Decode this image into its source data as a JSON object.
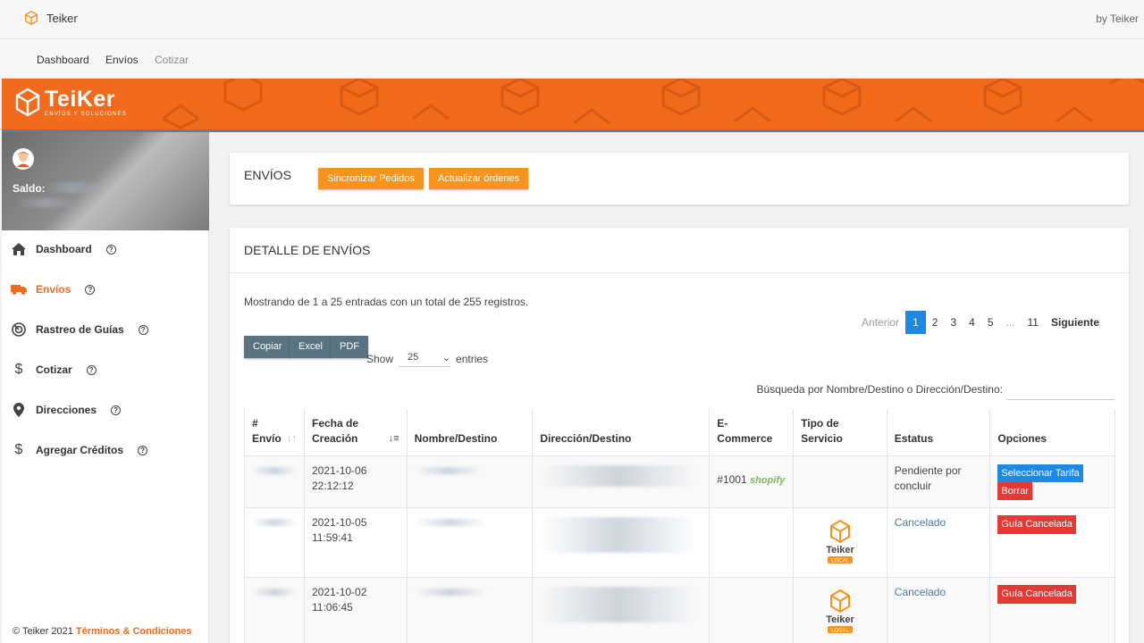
{
  "app": {
    "name": "Teiker",
    "by": "by Teiker"
  },
  "subnav": {
    "dashboard": "Dashboard",
    "envios": "Envíos",
    "cotizar": "Cotizar"
  },
  "banner": {
    "word": "TeiKer",
    "tagline": "ENVÍOS Y SOLUCIONES"
  },
  "profile": {
    "saldo_label": "Saldo:"
  },
  "sidebar": {
    "items": [
      {
        "label": "Dashboard",
        "icon": "home-icon"
      },
      {
        "label": "Envíos",
        "icon": "truck-icon",
        "active": true
      },
      {
        "label": "Rastreo de Guías",
        "icon": "radar-icon"
      },
      {
        "label": "Cotizar",
        "icon": "dollar-icon"
      },
      {
        "label": "Direcciones",
        "icon": "map-pin-icon"
      },
      {
        "label": "Agregar Créditos",
        "icon": "dollar-icon"
      }
    ],
    "help_glyph": "?",
    "footer_text": "© Teiker 2021",
    "footer_link": "Términos & Condiciones"
  },
  "envios_card": {
    "title": "ENVÍOS",
    "sync_button": "Sincronizar Pedidos",
    "update_button": "Actualizar órdenes"
  },
  "detail": {
    "title": "DETALLE DE ENVÍOS",
    "info": "Mostrando de 1 a 25 entradas con un total de 255 registros.",
    "pager": {
      "prev": "Anterior",
      "pages": [
        "1",
        "2",
        "3",
        "4",
        "5",
        "...",
        "11"
      ],
      "next": "Siguiente",
      "current": "1"
    },
    "export_buttons": [
      "Copiar",
      "Excel",
      "PDF"
    ],
    "show_label": "Show",
    "show_value": "25",
    "entries_label": "entries",
    "search_label": "Búsqueda por Nombre/Destino o Dirección/Destino:",
    "columns": {
      "envio_1": "#",
      "envio_2": "Envío",
      "fecha_1": "Fecha de",
      "fecha_2": "Creación",
      "nombre": "Nombre/Destino",
      "direccion": "Dirección/Destino",
      "ecom_1": "E-",
      "ecom_2": "Commerce",
      "tipo_1": "Tipo de",
      "tipo_2": "Servicio",
      "estatus": "Estatus",
      "opciones": "Opciones"
    },
    "rows": [
      {
        "date": "2021-10-06",
        "time": "22:12:12",
        "ecommerce_order": "#1001",
        "ecommerce_platform": "shopify",
        "status_1": "Pendiente por",
        "status_2": "concluir",
        "option_1": "Seleccionar Tarifa",
        "option_2": "Borrar"
      },
      {
        "date": "2021-10-05",
        "time": "11:59:41",
        "service_logo": "Teiker",
        "service_badge": "LOCAL",
        "status": "Cancelado",
        "option": "Guía Cancelada"
      },
      {
        "date": "2021-10-02",
        "time": "11:06:45",
        "service_logo": "Teiker",
        "service_badge": "LOCAL",
        "status": "Cancelado",
        "option": "Guía Cancelada"
      }
    ]
  },
  "colors": {
    "orange": "#f26b1d",
    "button_orange": "#f7941d",
    "blue": "#1e88e5",
    "red": "#e53935",
    "slate": "#5a7380"
  }
}
